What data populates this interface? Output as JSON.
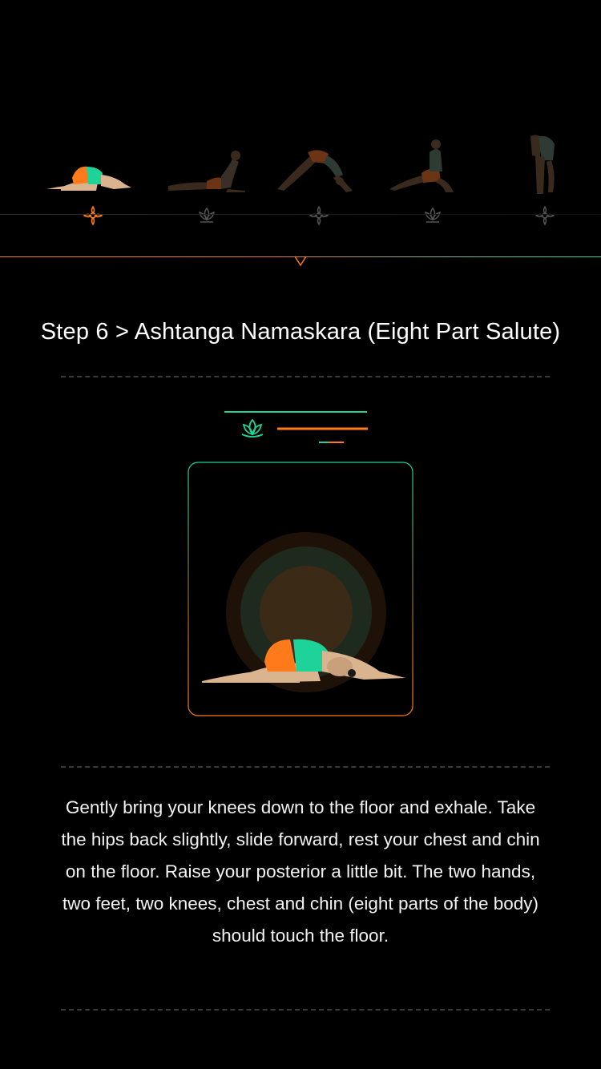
{
  "carousel": {
    "poses": [
      {
        "id": "ashtanga-namaskara",
        "active": true
      },
      {
        "id": "cobra-pose",
        "active": false
      },
      {
        "id": "downward-dog",
        "active": false
      },
      {
        "id": "lunge-pose",
        "active": false
      },
      {
        "id": "forward-fold",
        "active": false
      }
    ]
  },
  "step": {
    "title": "Step 6 > Ashtanga Namaskara (Eight Part Salute)",
    "description": "Gently bring your knees down to the floor and exhale. Take the hips back slightly, slide forward, rest your chest and chin on the floor. Raise your posterior a little bit. The two hands, two feet, two knees, chest and chin (eight parts of the body) should touch the floor."
  },
  "colors": {
    "accent_orange": "#ff7a1a",
    "accent_green": "#1ed39a",
    "skin": "#d9b48f",
    "background": "#000000"
  },
  "icons": [
    "lotus-icon",
    "flower-marker-icon"
  ]
}
